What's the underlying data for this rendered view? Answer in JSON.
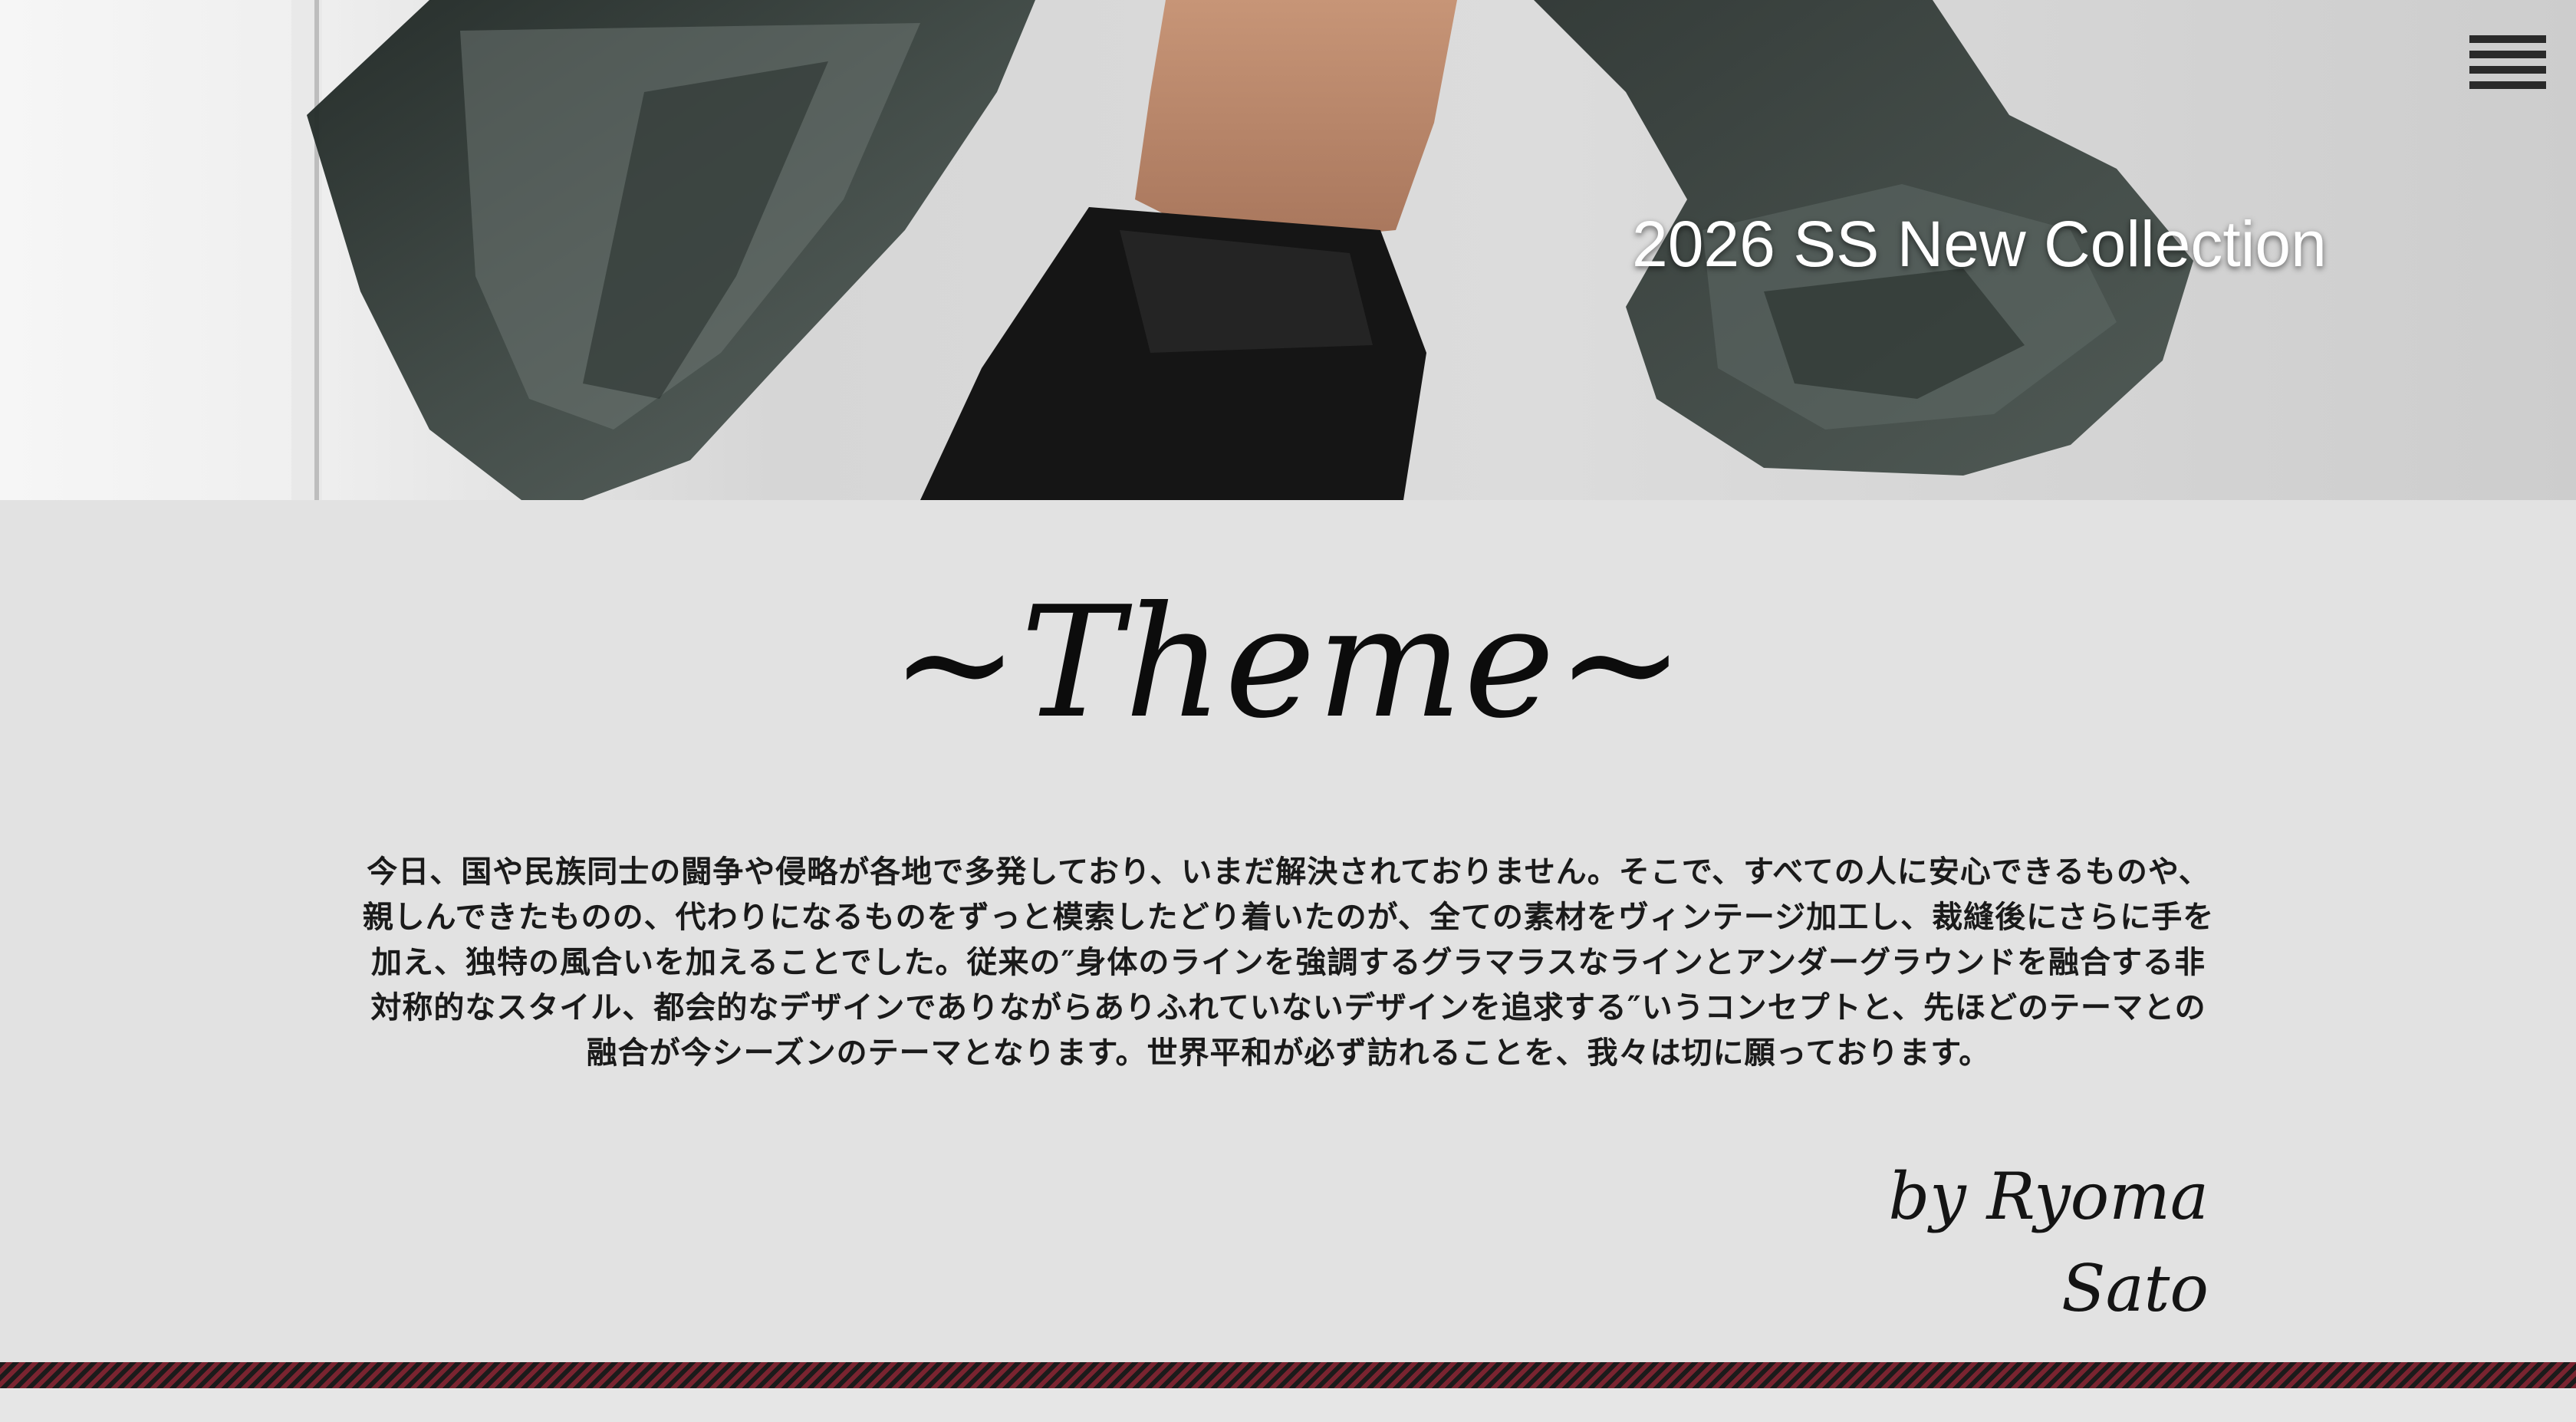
{
  "hero": {
    "title": "2026 SS New Collection",
    "image_alt": "Model in sheer black draped garment"
  },
  "menu": {
    "icon": "hamburger-menu-icon"
  },
  "theme": {
    "heading": "~Theme~",
    "body": "今日、国や民族同士の闘争や侵略が各地で多発しており、いまだ解決されておりません。そこで、すべての人に安心できるものや、親しんできたものの、代わりになるものをずっと模索したどり着いたのが、全ての素材をヴィンテージ加工し、裁縫後にさらに手を加え、独特の風合いを加えることでした。従来の″身体のラインを強調するグラマラスなラインとアンダーグラウンドを融合する非対称的なスタイル、都会的なデザインでありながらありふれていないデザインを追求する″いうコンセプトと、先ほどのテーマとの融合が今シーズンのテーマとなります。世界平和が必ず訪れることを、我々は切に願っております。",
    "signature": "by Ryoma Sato"
  },
  "colors": {
    "background": "#e2e2e2",
    "text": "#1a1a1a",
    "stripe_dark": "#1b1b1b",
    "stripe_accent": "#7a2430"
  }
}
